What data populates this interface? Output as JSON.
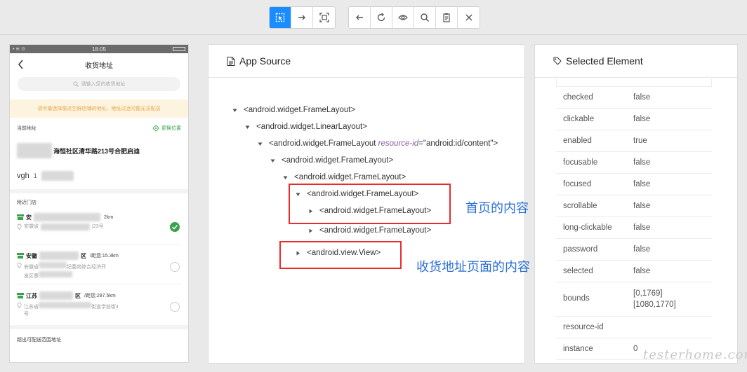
{
  "toolbar": {
    "left_group": [
      {
        "icon": "select-element-icon",
        "active": true
      },
      {
        "icon": "swipe-arrow-icon",
        "active": false
      },
      {
        "icon": "tap-coordinates-icon",
        "active": false
      }
    ],
    "right_group": [
      {
        "icon": "back-arrow-icon"
      },
      {
        "icon": "refresh-icon"
      },
      {
        "icon": "eye-icon"
      },
      {
        "icon": "search-icon"
      },
      {
        "icon": "copy-xml-icon"
      },
      {
        "icon": "close-icon"
      }
    ]
  },
  "phone": {
    "status_time": "18:05",
    "status_left": "• ≋ ⊙",
    "title": "收货地址",
    "search_placeholder": "请输入您的收货地址",
    "notice": "请尽量选择靠近生鲜店铺的地址，地址过远可能无法配送",
    "current_label": "当前地址",
    "change_location": "更换位置",
    "current_address": "海恒社区清华路213号合肥启迪",
    "current_name": "vgh",
    "current_phone_prefix": "1",
    "nearby_label": "附近门店",
    "stores": [
      {
        "name_prefix": "安",
        "name_suffix": "",
        "distance": "2km",
        "addr_prefix": "安徽省",
        "addr_suffix": "|23号",
        "addr_line2": "",
        "selected": true
      },
      {
        "name_prefix": "安徽",
        "name_suffix": "区",
        "distance": "/距您:15.3km",
        "addr_prefix": "安徽省",
        "addr_suffix": "纪委岗综合经济开",
        "addr_line2": "发区寨",
        "selected": false
      },
      {
        "name_prefix": "江苏",
        "name_suffix": "区",
        "distance": "/距您:287.5km",
        "addr_prefix": "江苏省",
        "addr_suffix": "街道学前街4",
        "addr_line2": "号",
        "selected": false
      }
    ],
    "out_of_range": "超出可配送范围地址"
  },
  "source_panel": {
    "title": "App Source",
    "nodes": [
      {
        "tag": "<android.widget.FrameLayout>",
        "caret": "down"
      },
      {
        "tag": "<android.widget.LinearLayout>",
        "caret": "down"
      },
      {
        "tag_open": "<android.widget.FrameLayout",
        "attr": "resource-id",
        "attr_val": "=\"android:id/content\">",
        "caret": "down"
      },
      {
        "tag": "<android.widget.FrameLayout>",
        "caret": "down"
      },
      {
        "tag": "<android.widget.FrameLayout>",
        "caret": "down"
      },
      {
        "tag": "<android.widget.FrameLayout>",
        "caret": "down"
      },
      {
        "tag": "<android.widget.FrameLayout>",
        "caret": "right"
      },
      {
        "tag": "<android.widget.FrameLayout>",
        "caret": "right"
      },
      {
        "tag": "<android.view.View>",
        "caret": "right"
      }
    ],
    "annotations": [
      "首页的内容",
      "收货地址页面的内容"
    ]
  },
  "element_panel": {
    "title": "Selected Element",
    "attributes": [
      {
        "k": "checked",
        "v": "false"
      },
      {
        "k": "clickable",
        "v": "false"
      },
      {
        "k": "enabled",
        "v": "true"
      },
      {
        "k": "focusable",
        "v": "false"
      },
      {
        "k": "focused",
        "v": "false"
      },
      {
        "k": "scrollable",
        "v": "false"
      },
      {
        "k": "long-clickable",
        "v": "false"
      },
      {
        "k": "password",
        "v": "false"
      },
      {
        "k": "selected",
        "v": "false"
      },
      {
        "k": "bounds",
        "v": "[0,1769][1080,1770]"
      },
      {
        "k": "resource-id",
        "v": ""
      },
      {
        "k": "instance",
        "v": "0"
      }
    ]
  },
  "watermark": "testerhome.com",
  "colors": {
    "accent": "#1a8cff",
    "highlight_box": "#e82c2c",
    "annotation": "#2c6fd6",
    "store_green": "#38a34a",
    "notice": "#e9a54a"
  }
}
